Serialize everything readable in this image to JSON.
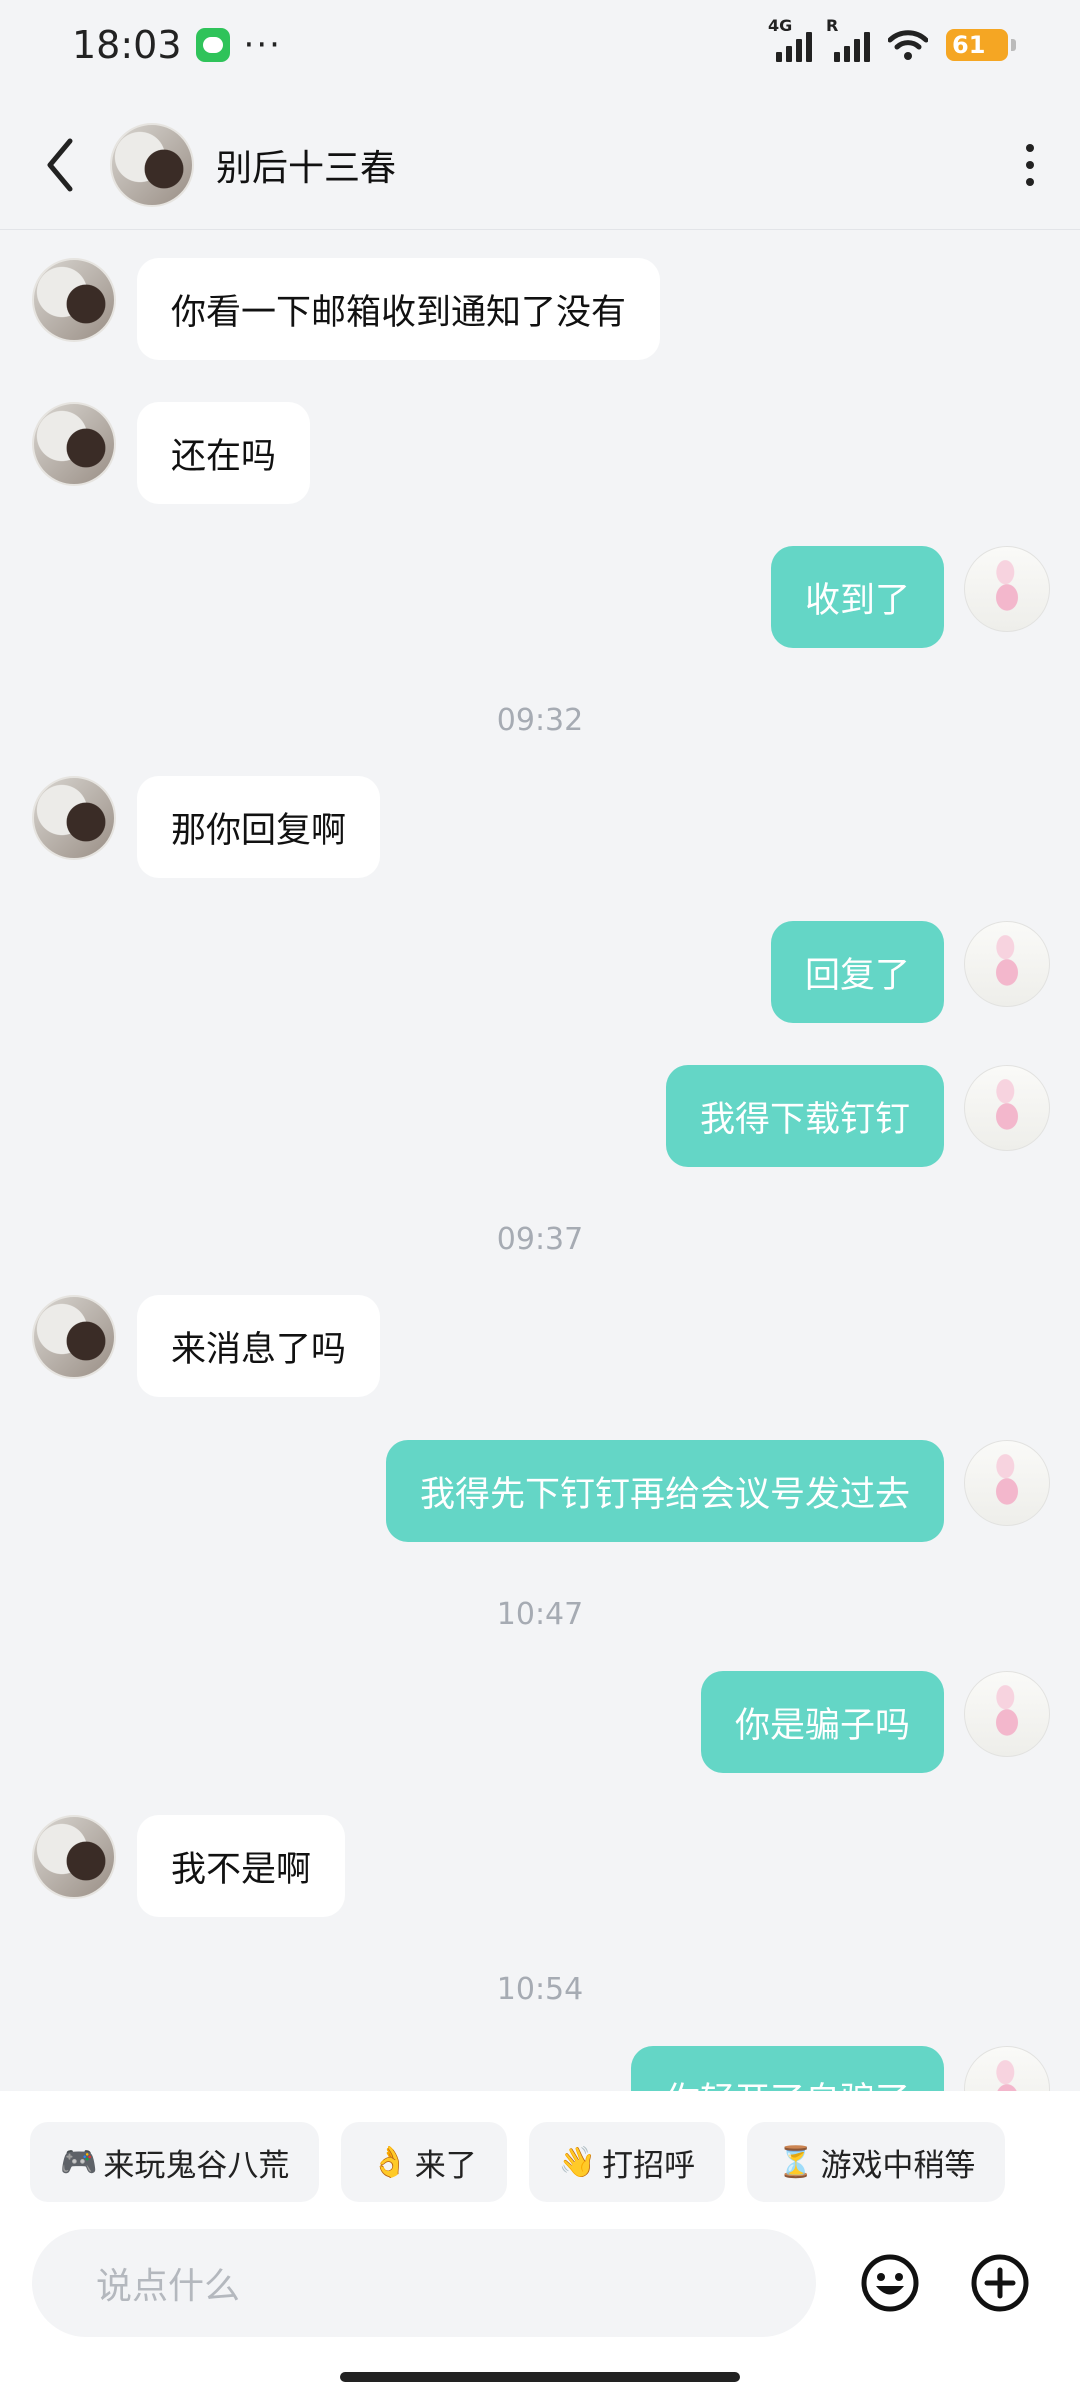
{
  "status_bar": {
    "time": "18:03",
    "more": "···",
    "signal1_tag": "4G",
    "signal2_tag": "R",
    "battery": "61"
  },
  "header": {
    "contact_name": "别后十三春"
  },
  "messages": [
    {
      "dir": "in",
      "text": "你看一下邮箱收到通知了没有"
    },
    {
      "dir": "in",
      "text": "还在吗"
    },
    {
      "dir": "out",
      "text": "收到了"
    },
    {
      "type": "time",
      "text": "09:32"
    },
    {
      "dir": "in",
      "text": "那你回复啊"
    },
    {
      "dir": "out",
      "text": "回复了"
    },
    {
      "dir": "out",
      "text": "我得下载钉钉"
    },
    {
      "type": "time",
      "text": "09:37"
    },
    {
      "dir": "in",
      "text": "来消息了吗"
    },
    {
      "dir": "out",
      "text": "我得先下钉钉再给会议号发过去"
    },
    {
      "type": "time",
      "text": "10:47"
    },
    {
      "dir": "out",
      "text": "你是骗子吗"
    },
    {
      "dir": "in",
      "text": "我不是啊"
    },
    {
      "type": "time",
      "text": "10:54"
    },
    {
      "dir": "out",
      "text": "你轻开了自骗了"
    }
  ],
  "quick_replies": [
    {
      "emoji": "🎮",
      "label": "来玩鬼谷八荒"
    },
    {
      "emoji": "👌",
      "label": "来了"
    },
    {
      "emoji": "👋",
      "label": "打招呼"
    },
    {
      "emoji": "⏳",
      "label": "游戏中稍等"
    }
  ],
  "composer": {
    "placeholder": "说点什么"
  },
  "colors": {
    "outgoing_bubble": "#64d6c6",
    "incoming_bubble": "#ffffff",
    "background": "#f3f4f6"
  }
}
